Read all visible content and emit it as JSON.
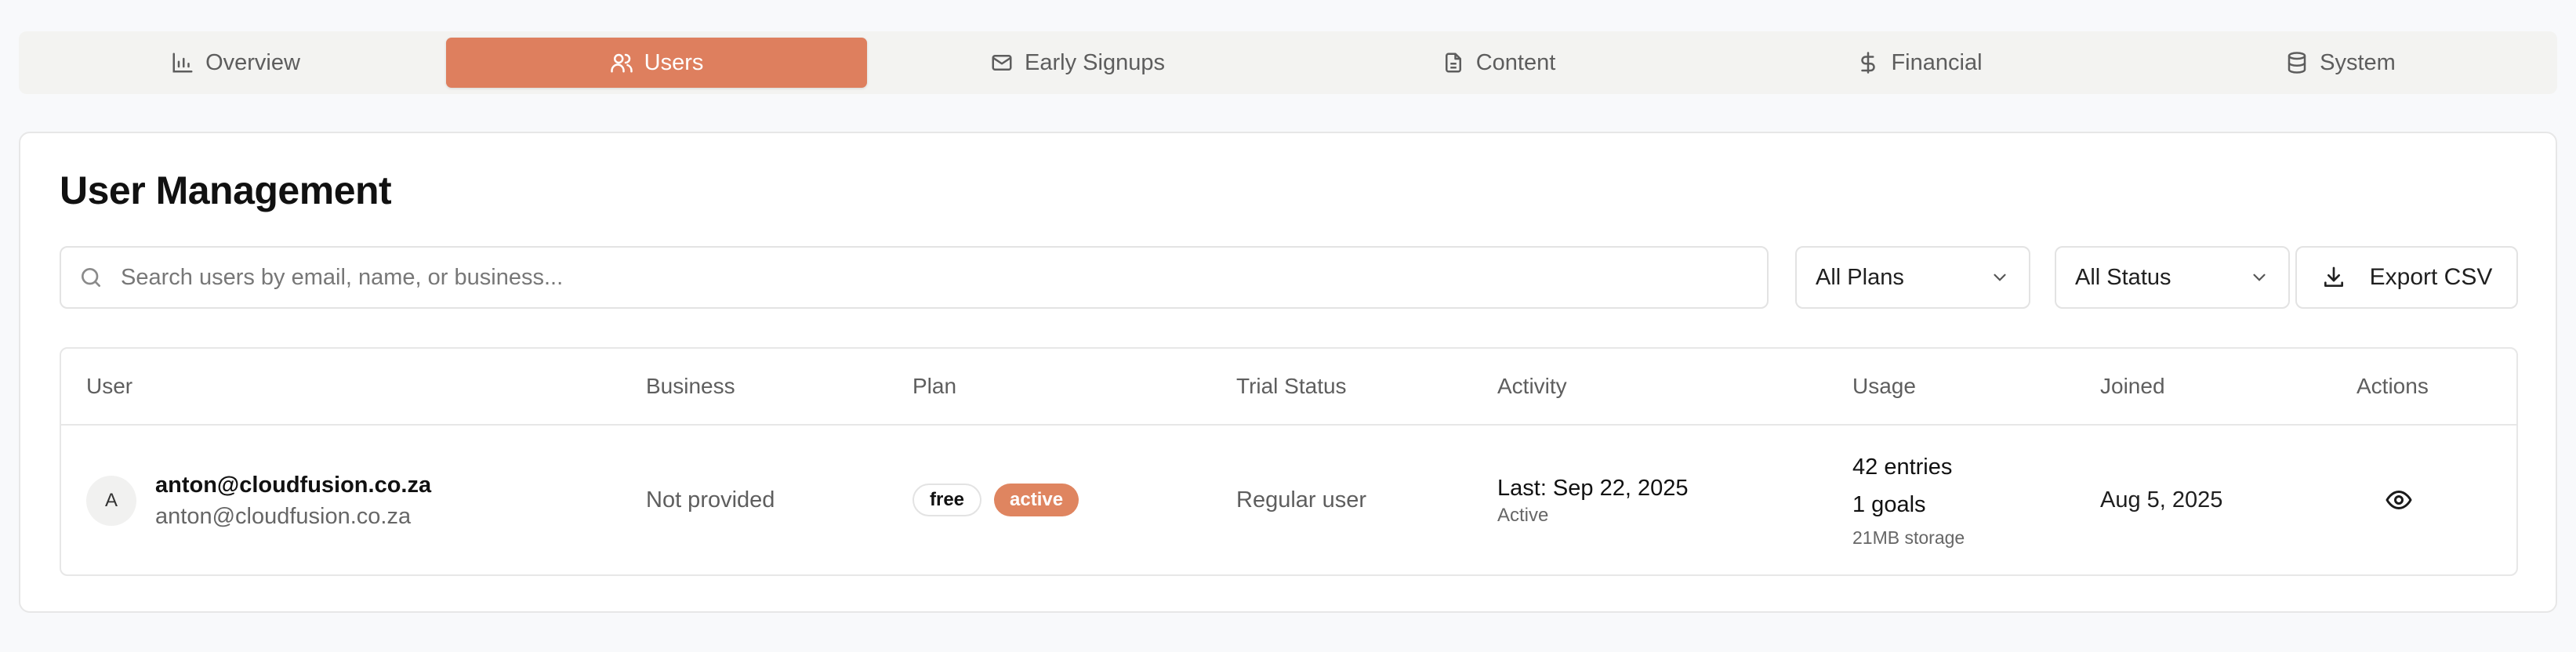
{
  "tabs": [
    {
      "label": "Overview",
      "icon": "bar-chart-icon",
      "active": false
    },
    {
      "label": "Users",
      "icon": "users-icon",
      "active": true
    },
    {
      "label": "Early Signups",
      "icon": "mail-icon",
      "active": false
    },
    {
      "label": "Content",
      "icon": "document-icon",
      "active": false
    },
    {
      "label": "Financial",
      "icon": "dollar-icon",
      "active": false
    },
    {
      "label": "System",
      "icon": "database-icon",
      "active": false
    }
  ],
  "page": {
    "title": "User Management"
  },
  "search": {
    "placeholder": "Search users by email, name, or business...",
    "value": ""
  },
  "filters": {
    "plan": "All Plans",
    "status": "All Status"
  },
  "export": {
    "label": "Export CSV"
  },
  "table": {
    "columns": [
      "User",
      "Business",
      "Plan",
      "Trial Status",
      "Activity",
      "Usage",
      "Joined",
      "Actions"
    ],
    "rows": [
      {
        "avatar": "A",
        "email": "anton@cloudfusion.co.za",
        "subtitle": "anton@cloudfusion.co.za",
        "business": "Not provided",
        "plan": "free",
        "plan_status": "active",
        "trial_status": "Regular user",
        "activity_last": "Last: Sep 22, 2025",
        "activity_state": "Active",
        "usage_entries": "42 entries",
        "usage_goals": "1 goals",
        "usage_storage": "21MB storage",
        "joined": "Aug 5, 2025",
        "action_icon": "eye-icon"
      }
    ]
  },
  "colors": {
    "accent": "#de7f5e",
    "badge_active": "#df8560",
    "tabbar_bg": "#f3f3f1",
    "page_bg": "#f8f9fb"
  }
}
